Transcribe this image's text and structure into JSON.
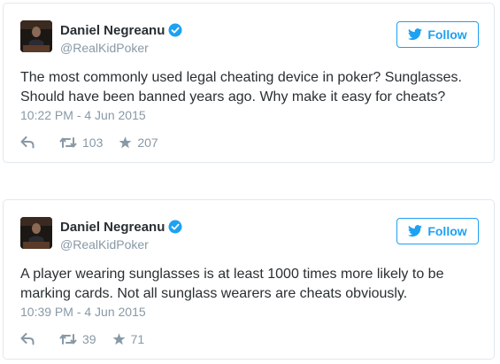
{
  "tweets": [
    {
      "author": {
        "name": "Daniel Negreanu",
        "handle": "@RealKidPoker",
        "verified": true
      },
      "follow_label": "Follow",
      "text": "The most commonly used legal cheating device in poker? Sunglasses.\nShould have been banned years ago. Why make it easy for cheats?",
      "timestamp": "10:22 PM - 4 Jun 2015",
      "retweets": "103",
      "likes": "207"
    },
    {
      "author": {
        "name": "Daniel Negreanu",
        "handle": "@RealKidPoker",
        "verified": true
      },
      "follow_label": "Follow",
      "text": "A player wearing sunglasses is at least 1000 times more likely to be\nmarking cards. Not all sunglass wearers are cheats obviously.",
      "timestamp": "10:39 PM - 4 Jun 2015",
      "retweets": "39",
      "likes": "71"
    }
  ],
  "icons": {
    "verified": "verified-badge-icon",
    "follow": "bird-icon",
    "reply": "reply-icon",
    "retweet": "retweet-icon",
    "like": "star-icon"
  },
  "colors": {
    "accent": "#1da1f2",
    "muted": "#8899a6",
    "text": "#292f33",
    "border": "#e1e8ed"
  }
}
